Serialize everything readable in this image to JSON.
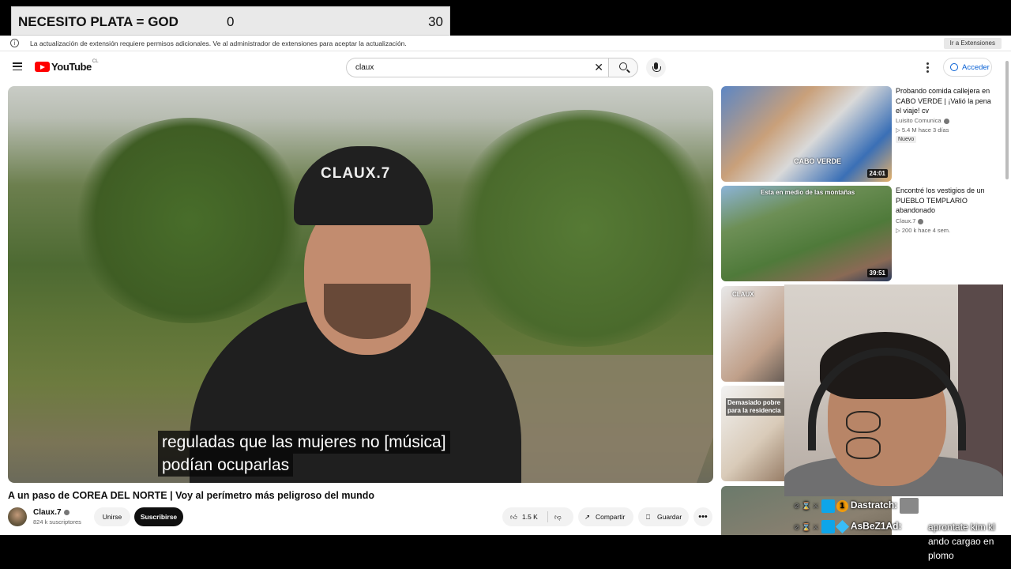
{
  "overlay": {
    "title": "NECESITO PLATA = GOD",
    "count_left": "0",
    "count_right": "30"
  },
  "notice": {
    "text": "La actualización de extensión requiere permisos adicionales. Ve al administrador de extensiones para aceptar la actualización.",
    "button": "Ir a Extensiones"
  },
  "header": {
    "logo_text": "YouTube",
    "country": "CL",
    "search_value": "claux",
    "signin_label": "Acceder"
  },
  "player": {
    "cap_text": "CLAUX.7",
    "caption_line1": "reguladas que las mujeres no [música]",
    "caption_line2": "podían ocuparlas"
  },
  "video": {
    "title": "A un paso de COREA DEL NORTE | Voy al perímetro más peligroso del mundo",
    "channel": "Claux.7",
    "subscribers": "824 k suscriptores",
    "join_label": "Unirse",
    "subscribe_label": "Suscribirse",
    "likes": "1.5 K",
    "share_label": "Compartir",
    "save_label": "Guardar",
    "more": "•••"
  },
  "recommendations": [
    {
      "title": "Probando comida callejera en CABO VERDE | ¡Valió la pena el viaje! cv",
      "channel": "Luisito Comunica",
      "meta": "▷ 5.4 M  hace 3 días",
      "badge": "Nuevo",
      "duration": "24:01",
      "shirt_text": "CABO VERDE"
    },
    {
      "title": "Encontré los vestigios de un PUEBLO TEMPLARIO abandonado",
      "channel": "Claux.7",
      "meta": "▷ 200 k  hace 4 sem.",
      "duration": "39:51",
      "thumb_text": "Esta en medio de las montañas"
    },
    {
      "thumb_text": "CLAUX"
    },
    {
      "thumb_text": "Demasiado pobre para la residencia"
    }
  ],
  "chat": [
    {
      "user": "Dastratch:",
      "message": ""
    },
    {
      "user": "AsBeZ1Ad:",
      "message": "aprontate kim kl ando cargao en plomo"
    }
  ],
  "colors": {
    "youtube_red": "#ff0000",
    "link_blue": "#065fd4",
    "subscribe_bg": "#0f0f0f"
  }
}
